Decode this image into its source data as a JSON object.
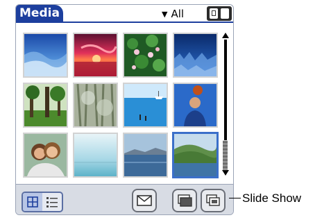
{
  "app": {
    "title": "Media"
  },
  "category": {
    "selected": "All"
  },
  "media_items": [
    {
      "name": "Blue waves"
    },
    {
      "name": "Sunset"
    },
    {
      "name": "Water lilies"
    },
    {
      "name": "Underwater"
    },
    {
      "name": "Forest"
    },
    {
      "name": "Frosted trees"
    },
    {
      "name": "Beach with boat"
    },
    {
      "name": "Man with ball"
    },
    {
      "name": "Two friends"
    },
    {
      "name": "Misty sea"
    },
    {
      "name": "Lake"
    },
    {
      "name": "Green hills",
      "selected": true
    }
  ],
  "toolbar": {
    "grid_view_icon": "grid-icon",
    "list_view_icon": "list-icon",
    "send_icon": "envelope-icon",
    "details_icon": "folder-icon",
    "slideshow_icon": "slideshow-icon"
  },
  "callout": {
    "label": "Slide Show"
  },
  "colors": {
    "title_bar": "#1d3f9e",
    "selection": "#3b6fc9"
  }
}
